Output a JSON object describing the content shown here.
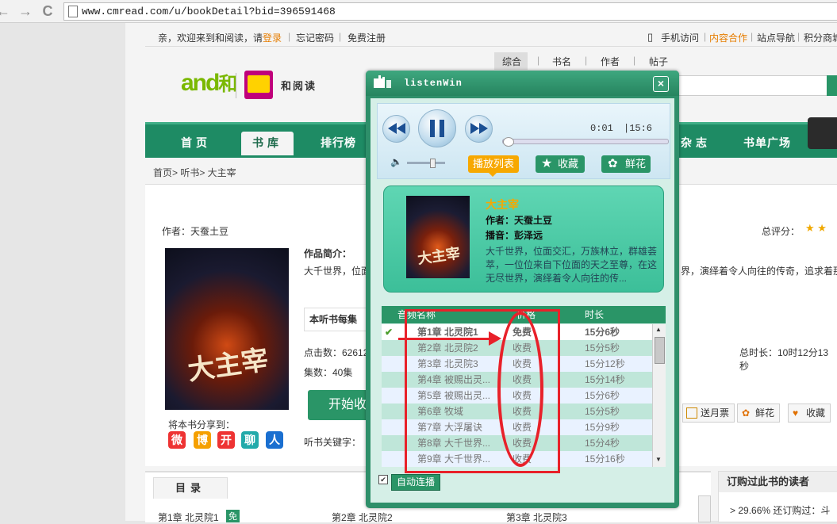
{
  "browser": {
    "back": "←",
    "forward": "→",
    "reload": "C",
    "url": "www.cmread.com/u/bookDetail?bid=396591468"
  },
  "top_links": {
    "welcome": "亲，欢迎来到和阅读，请",
    "login": "登录",
    "forgot": "忘记密码",
    "register": "免费注册",
    "mobile": "手机访问",
    "cooperate": "内容合作",
    "site_nav": "站点导航",
    "points": "积分商城",
    "sep": "|"
  },
  "logo": {
    "and": "and",
    "he": "和",
    "read": "和阅读"
  },
  "search_tabs": [
    "综合",
    "书名",
    "作者",
    "帖子"
  ],
  "nav": [
    "首页",
    "书库",
    "排行榜",
    "杂志",
    "书单广场"
  ],
  "breadcrumb": "首页> 听书> 大主宰",
  "book_page": {
    "author": "作者：天蚕土豆",
    "rating_label": "总评分：",
    "intro_label": "作品简介：",
    "intro_text": "大千世界，位面",
    "intro_text_right": "界，演绎着令人向往的传奇，追求着那",
    "tip": "本听书每集",
    "clicks": "点击数：62612",
    "episodes": "集数：40集",
    "total_duration": "总时长：10时12分13秒",
    "start_btn": "开始收",
    "monthly_ticket": "送月票",
    "flower": "鲜花",
    "favorite": "收藏",
    "share_label": "将本书分享到：",
    "keywords": "听书关键字：",
    "cover_title": "大主宰"
  },
  "share_icons": [
    "微",
    "博",
    "开",
    "聊",
    "人"
  ],
  "directory": {
    "tab": "目录",
    "items": [
      "第1章 北灵院1",
      "第2章 北灵院2",
      "第3章 北灵院3"
    ],
    "free_badge": "免"
  },
  "right_box": {
    "title": "订购过此书的读者",
    "line": "> 29.66% 还订购过：斗"
  },
  "popup": {
    "title": "listenWin",
    "close": "×",
    "time_now": "0:01",
    "time_total": "|15:6",
    "progress_fraction": 0.03,
    "volume_fraction": 0.6,
    "btn_playlist": "播放列表",
    "btn_fav": "收藏",
    "btn_flower": "鲜花",
    "book_title": "大主宰",
    "author": "作者：天蚕土豆",
    "reader": "播音：彭泽远",
    "description": "大千世界，位面交汇，万族林立，群雄荟萃，一位位来自下位面的天之至尊，在这无尽世界，演绎着令人向往的传...",
    "cover_title": "大主宰",
    "col_name": "音频名称",
    "col_price": "价格",
    "col_duration": "时长",
    "auto_play": "自动连播",
    "auto_play_checked": "✔",
    "rows": [
      {
        "name": "第1章  北灵院1",
        "price": "免费",
        "duration": "15分6秒"
      },
      {
        "name": "第2章  北灵院2",
        "price": "收费",
        "duration": "15分5秒"
      },
      {
        "name": "第3章  北灵院3",
        "price": "收费",
        "duration": "15分12秒"
      },
      {
        "name": "第4章  被赐出灵...",
        "price": "收费",
        "duration": "15分14秒"
      },
      {
        "name": "第5章  被赐出灵...",
        "price": "收费",
        "duration": "15分6秒"
      },
      {
        "name": "第6章  牧域",
        "price": "收费",
        "duration": "15分5秒"
      },
      {
        "name": "第7章  大浮屠诀",
        "price": "收费",
        "duration": "15分9秒"
      },
      {
        "name": "第8章  大千世界...",
        "price": "收费",
        "duration": "15分4秒"
      },
      {
        "name": "第9章  大千世界...",
        "price": "收费",
        "duration": "15分16秒"
      }
    ],
    "current_check": "✔"
  },
  "colors": {
    "nav_green": "#1e8b64",
    "popup_green": "#2e8f6a",
    "accent_orange": "#f7a800",
    "annotation_red": "#e8212a"
  }
}
